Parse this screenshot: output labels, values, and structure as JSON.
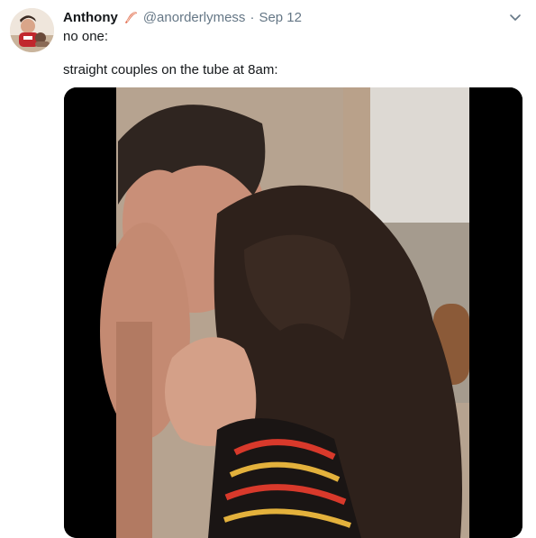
{
  "tweet": {
    "author": {
      "name": "Anthony",
      "handle": "@anorderlymess",
      "emoji": "bacon-emoji"
    },
    "separator": "·",
    "date": "Sep 12",
    "lines": [
      "no one:",
      "straight couples on the tube at 8am:"
    ],
    "media": {
      "type": "video-frame"
    },
    "menu_icon": "chevron-down-icon"
  },
  "colors": {
    "text_primary": "#14171a",
    "text_secondary": "#657786",
    "media_background": "#000000"
  }
}
